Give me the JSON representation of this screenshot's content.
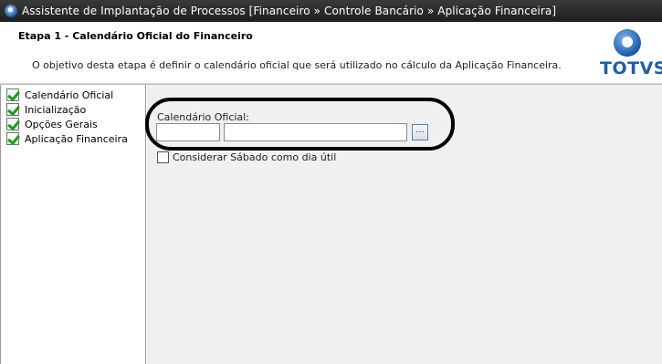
{
  "window": {
    "title": "Assistente de Implantação de Processos [Financeiro » Controle Bancário » Aplicação Financeira]"
  },
  "header": {
    "step_title": "Etapa 1 - Calendário Oficial do Financeiro",
    "description": "O objetivo desta etapa é definir o calendário oficial que será utilizado no cálculo da Aplicação Financeira.",
    "logo_text": "TOTVS"
  },
  "steps": [
    {
      "label": "Calendário Oficial",
      "icon": "checked-icon"
    },
    {
      "label": "Inicialização",
      "icon": "checked-icon"
    },
    {
      "label": "Opções Gerais",
      "icon": "checked-icon"
    },
    {
      "label": "Aplicação Financeira",
      "icon": "checked-icon"
    }
  ],
  "form": {
    "calendar_label": "Calendário Oficial:",
    "calendar_code_value": "",
    "calendar_desc_value": "",
    "lookup_button": "...",
    "saturday_checkbox_label": "Considerar Sábado como dia útil",
    "saturday_checked": false
  },
  "colors": {
    "title_bar": "#262626",
    "logo_blue": "#1f5da8",
    "panel_bg": "#f0f0f0"
  }
}
